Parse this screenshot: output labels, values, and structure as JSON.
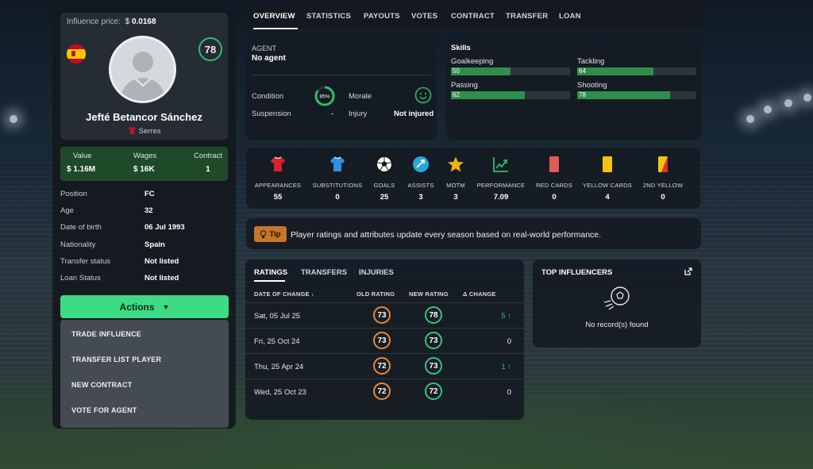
{
  "profile": {
    "influence_label": "Influence price:",
    "influence_value": "0.0168",
    "currency_icon": "coin-icon",
    "overall_rating": "78",
    "name": "Jefté Betancor Sánchez",
    "club": "Serres",
    "club_colors": {
      "shirt": "#c8102e"
    }
  },
  "finance": {
    "value_label": "Value",
    "value": "1.16M",
    "wages_label": "Wages",
    "wages": "16K",
    "contract_label": "Contract",
    "contract": "1"
  },
  "details": [
    {
      "label": "Position",
      "value": "FC"
    },
    {
      "label": "Age",
      "value": "32"
    },
    {
      "label": "Date of birth",
      "value": "06 Jul 1993"
    },
    {
      "label": "Nationality",
      "value": "Spain"
    },
    {
      "label": "Transfer status",
      "value": "Not listed"
    },
    {
      "label": "Loan Status",
      "value": "Not listed"
    }
  ],
  "actions": {
    "label": "Actions",
    "menu": [
      "TRADE INFLUENCE",
      "TRANSFER LIST PLAYER",
      "NEW CONTRACT",
      "VOTE FOR AGENT"
    ]
  },
  "nav": {
    "tabs": [
      "OVERVIEW",
      "STATISTICS",
      "PAYOUTS",
      "VOTES",
      "CONTRACT",
      "TRANSFER",
      "LOAN"
    ],
    "active": "OVERVIEW"
  },
  "agent": {
    "label": "AGENT",
    "value": "No agent",
    "condition_label": "Condition",
    "condition_value": "85%",
    "condition_fraction": 0.85,
    "morale_label": "Morale",
    "morale_icon": "smile-icon",
    "suspension_label": "Suspension",
    "suspension_value": "-",
    "injury_label": "Injury",
    "injury_value": "Not injured"
  },
  "skills": {
    "title": "Skills",
    "items": [
      {
        "name": "Goalkeeping",
        "value": 50
      },
      {
        "name": "Tackling",
        "value": 64
      },
      {
        "name": "Passing",
        "value": 62
      },
      {
        "name": "Shooting",
        "value": 78
      }
    ]
  },
  "stats": [
    {
      "label": "APPEARANCES",
      "value": "55",
      "icon": "red-shirt-icon"
    },
    {
      "label": "SUBSTITUTIONS",
      "value": "0",
      "icon": "blue-shirt-icon"
    },
    {
      "label": "GOALS",
      "value": "25",
      "icon": "football-icon"
    },
    {
      "label": "ASSISTS",
      "value": "3",
      "icon": "assist-icon"
    },
    {
      "label": "MOTM",
      "value": "3",
      "icon": "star-icon"
    },
    {
      "label": "PERFORMANCE",
      "value": "7.09",
      "icon": "trend-icon"
    },
    {
      "label": "RED CARDS",
      "value": "0",
      "icon": "red-card-icon"
    },
    {
      "label": "YELLOW CARDS",
      "value": "4",
      "icon": "yellow-card-icon"
    },
    {
      "label": "2ND YELLOW",
      "value": "0",
      "icon": "second-yellow-icon"
    }
  ],
  "tip": {
    "badge": "Tip",
    "text": "Player ratings and attributes update every season based on real-world performance."
  },
  "ratings": {
    "tabs": [
      "RATINGS",
      "TRANSFERS",
      "INJURIES"
    ],
    "active_tab": "RATINGS",
    "headers": {
      "date": "DATE OF CHANGE",
      "old": "OLD RATING",
      "new": "NEW RATING",
      "change": "Δ CHANGE"
    },
    "rows": [
      {
        "date": "Sat, 05 Jul 25",
        "old": "73",
        "new": "78",
        "change": "5",
        "up": true
      },
      {
        "date": "Fri, 25 Oct 24",
        "old": "73",
        "new": "73",
        "change": "0",
        "up": false
      },
      {
        "date": "Thu, 25 Apr 24",
        "old": "72",
        "new": "73",
        "change": "1",
        "up": true
      },
      {
        "date": "Wed, 25 Oct 23",
        "old": "72",
        "new": "72",
        "change": "0",
        "up": false
      }
    ]
  },
  "top_influencers": {
    "title": "TOP INFLUENCERS",
    "empty_text": "No record(s) found",
    "empty_icon": "football-kick-icon"
  },
  "colors": {
    "accent": "#3ddc84",
    "rating_old": "#e8893a",
    "rating_new": "#35c47a",
    "skill_bar": "#2f8f4a",
    "tip_badge": "#c8752a",
    "value_box": "#1f4a2a"
  }
}
